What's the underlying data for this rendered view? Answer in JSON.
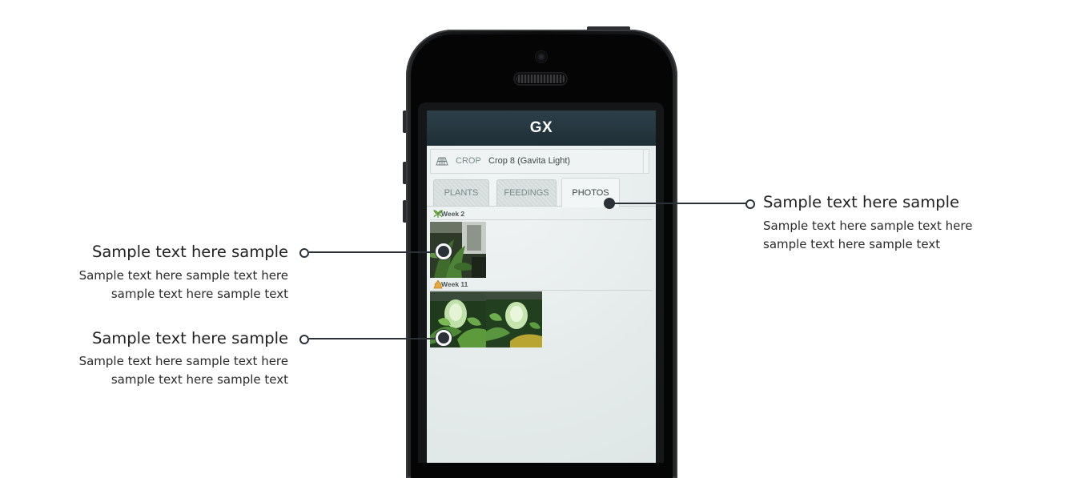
{
  "app": {
    "title": "GX",
    "crop": {
      "label": "CROP",
      "value": "Crop 8 (Gavita Light)"
    },
    "tabs": [
      {
        "label": "PLANTS",
        "active": false
      },
      {
        "label": "FEEDINGS",
        "active": false
      },
      {
        "label": "PHOTOS",
        "active": true
      }
    ],
    "weeks": [
      {
        "label": "Week 2",
        "icon": "leaf-icon",
        "photo_count": 1
      },
      {
        "label": "Week 11",
        "icon": "flower-icon",
        "photo_count": 2
      }
    ]
  },
  "callouts": [
    {
      "title": "Sample text here sample",
      "body": "Sample text here sample text here sample text here sample text",
      "side": "right"
    },
    {
      "title": "Sample text here sample",
      "body": "Sample text here sample text here sample text here sample text",
      "side": "left"
    },
    {
      "title": "Sample text here sample",
      "body": "Sample text here sample text here sample text here sample text",
      "side": "left"
    }
  ],
  "colors": {
    "navbar": "#243640",
    "connector": "#2a3238",
    "screen_bg": "#e9eeee"
  }
}
